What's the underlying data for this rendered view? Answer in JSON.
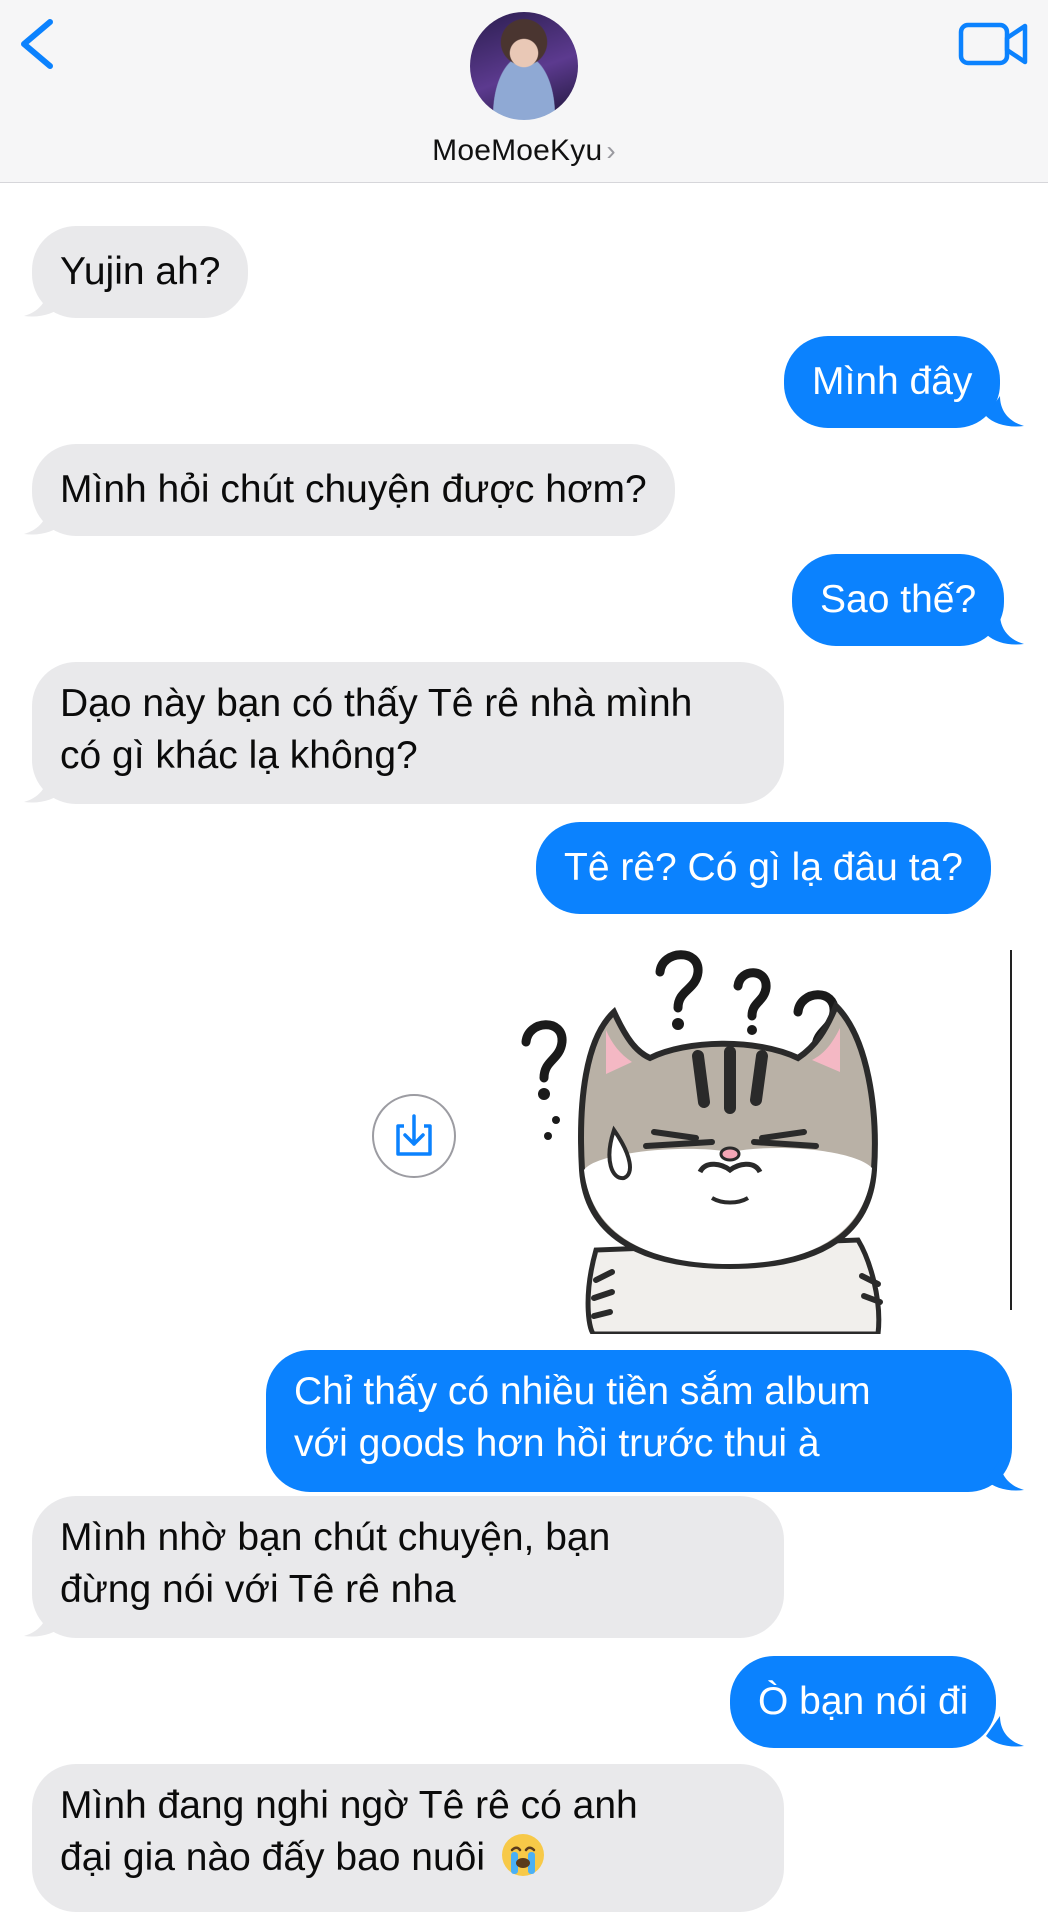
{
  "header": {
    "contact_name": "MoeMoeKyu",
    "back_icon": "chevron-left-icon",
    "video_icon": "video-camera-icon",
    "accent": "#0b82fe"
  },
  "messages": [
    {
      "from": "them",
      "lines": [
        "Yujin ah?"
      ]
    },
    {
      "from": "me",
      "lines": [
        "Mình đây"
      ]
    },
    {
      "from": "them",
      "lines": [
        "Mình hỏi chút chuyện được hơm?"
      ]
    },
    {
      "from": "me",
      "lines": [
        "Sao thế?"
      ]
    },
    {
      "from": "them",
      "lines": [
        "Dạo này bạn có thấy Tê rê nhà mình",
        "có gì khác lạ không?"
      ]
    },
    {
      "from": "me",
      "lines": [
        "Tê rê? Có gì lạ đâu ta?"
      ]
    },
    {
      "from": "me",
      "type": "sticker",
      "description": "confused-cat-sticker"
    },
    {
      "from": "me",
      "lines": [
        "Chỉ thấy có nhiều tiền sắm album",
        "với goods hơn hồi trước thui à"
      ]
    },
    {
      "from": "them",
      "lines": [
        "Mình nhờ bạn chút chuyện, bạn",
        "đừng nói với Tê rê nha"
      ]
    },
    {
      "from": "me",
      "lines": [
        "Ò bạn nói đi"
      ]
    },
    {
      "from": "them",
      "lines": [
        "Mình đang nghi ngờ Tê rê có anh",
        "đại gia nào đấy bao nuôi"
      ],
      "emoji": "loudly-crying-face-icon"
    }
  ],
  "colors": {
    "incoming_bubble": "#e9e9eb",
    "outgoing_bubble": "#0b82fe",
    "header_bg": "#f6f6f7"
  }
}
